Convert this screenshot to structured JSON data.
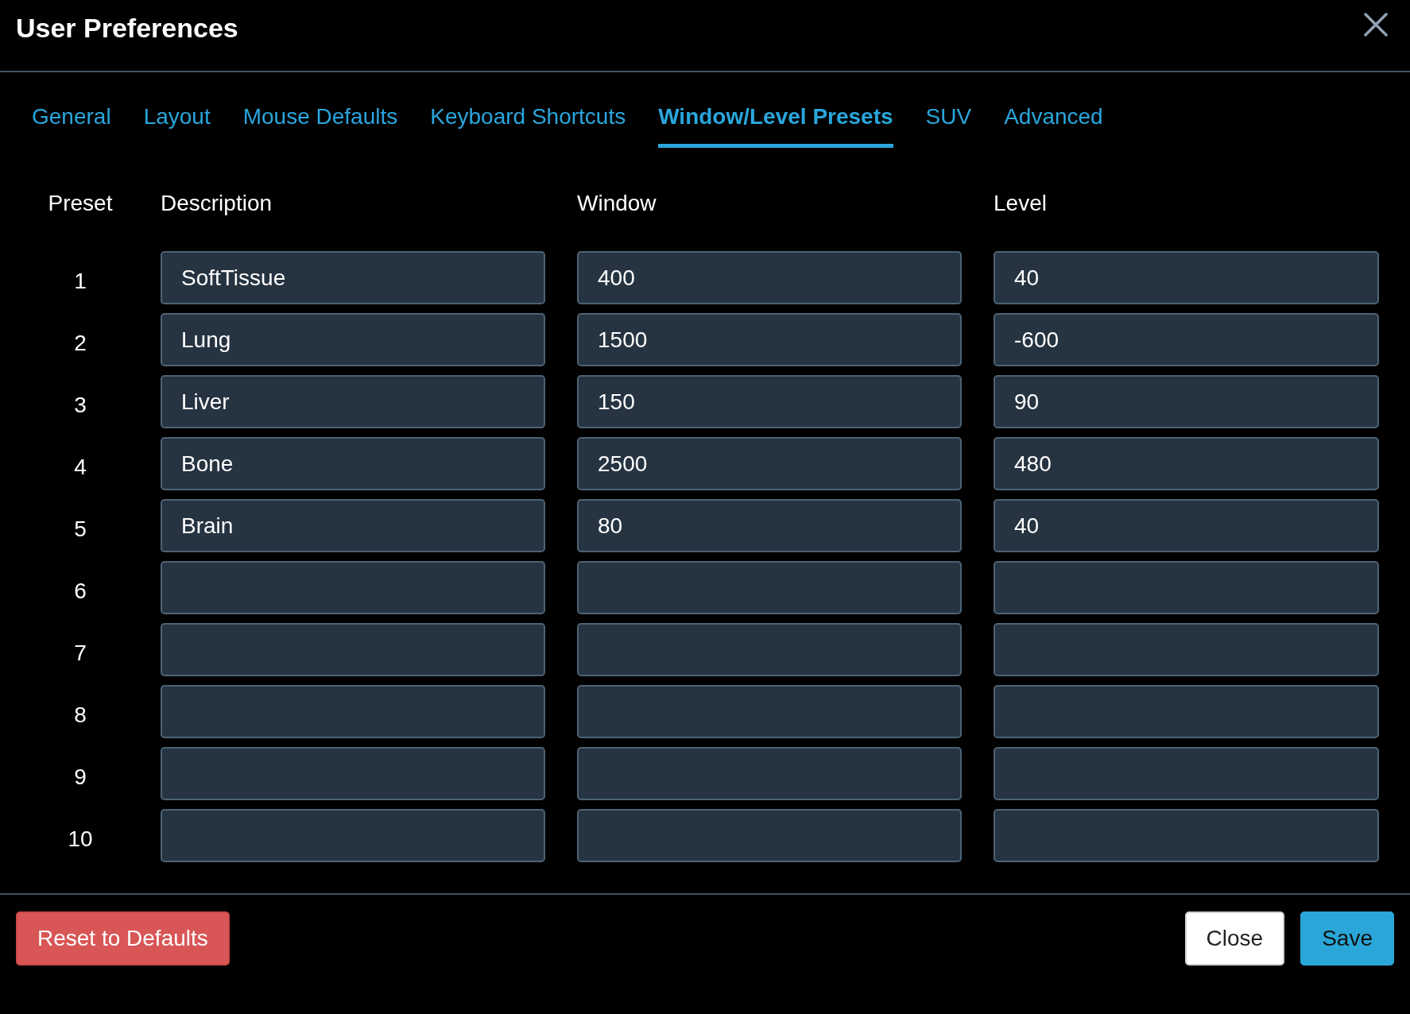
{
  "window": {
    "title": "User Preferences"
  },
  "tabs": [
    {
      "label": "General",
      "selected": false
    },
    {
      "label": "Layout",
      "selected": false
    },
    {
      "label": "Mouse Defaults",
      "selected": false
    },
    {
      "label": "Keyboard Shortcuts",
      "selected": false
    },
    {
      "label": "Window/Level Presets",
      "selected": true
    },
    {
      "label": "SUV",
      "selected": false
    },
    {
      "label": "Advanced",
      "selected": false
    }
  ],
  "table": {
    "columns": [
      "Preset",
      "Description",
      "Window",
      "Level"
    ],
    "rows": [
      {
        "preset": "1",
        "description": "SoftTissue",
        "window": "400",
        "level": "40"
      },
      {
        "preset": "2",
        "description": "Lung",
        "window": "1500",
        "level": "-600"
      },
      {
        "preset": "3",
        "description": "Liver",
        "window": "150",
        "level": "90"
      },
      {
        "preset": "4",
        "description": "Bone",
        "window": "2500",
        "level": "480"
      },
      {
        "preset": "5",
        "description": "Brain",
        "window": "80",
        "level": "40"
      },
      {
        "preset": "6"
      },
      {
        "preset": "7"
      },
      {
        "preset": "8"
      },
      {
        "preset": "9"
      },
      {
        "preset": "10"
      }
    ]
  },
  "buttons": [
    {
      "label": "Reset to Defaults",
      "kind": "danger"
    },
    {
      "label": "Close",
      "kind": "secondary"
    },
    {
      "label": "Save",
      "kind": "primary"
    }
  ]
}
